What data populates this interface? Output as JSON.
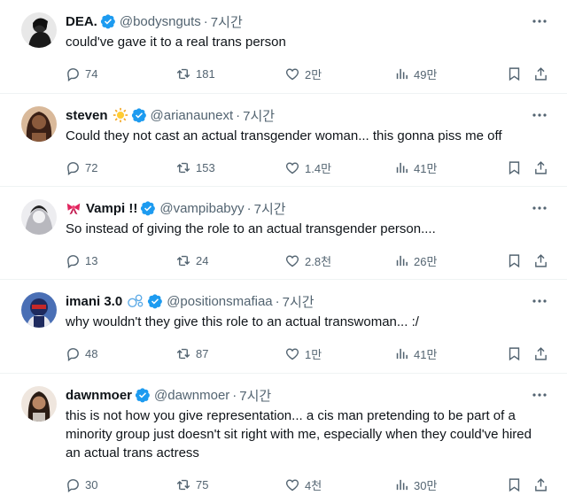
{
  "tweets": [
    {
      "name": "DEA.",
      "emoji": "",
      "handle": "@bodysnguts",
      "time": "7시간",
      "text": "could've gave it to a real trans person",
      "replies": "74",
      "retweets": "181",
      "likes": "2만",
      "views": "49만",
      "avatar_color": "#2b2b2b"
    },
    {
      "name": "steven",
      "emoji": "sun-emoji",
      "handle": "@arianaunext",
      "time": "7시간",
      "text": "Could they not cast an actual transgender woman... this gonna piss me off",
      "replies": "72",
      "retweets": "153",
      "likes": "1.4만",
      "views": "41만",
      "avatar_color": "#6b3f2a"
    },
    {
      "name": "Vampi !!",
      "emoji": "ribbon-emoji",
      "handle": "@vampibabyy",
      "time": "7시간",
      "text": "So instead of giving the role to an actual transgender person....",
      "replies": "13",
      "retweets": "24",
      "likes": "2.8천",
      "views": "26만",
      "avatar_color": "#c9c9cc"
    },
    {
      "name": "imani 3.0",
      "emoji": "bubbles-emoji",
      "handle": "@positionsmafiaa",
      "time": "7시간",
      "text": "why wouldn't they give this role to an actual transwoman... :/",
      "replies": "48",
      "retweets": "87",
      "likes": "1만",
      "views": "41만",
      "avatar_color": "#2a3a7a"
    },
    {
      "name": "dawnmoer",
      "emoji": "",
      "handle": "@dawnmoer",
      "time": "7시간",
      "text": "this is not how you give representation... a cis man pretending to be part of a minority group just doesn't sit right with me, especially when they could've hired an actual trans actress",
      "replies": "30",
      "retweets": "75",
      "likes": "4천",
      "views": "30만",
      "avatar_color": "#7a5a44"
    }
  ],
  "colors": {
    "verified": "#1d9bf0",
    "muted": "#536471",
    "text": "#0f1419",
    "divider": "#eff3f4"
  }
}
